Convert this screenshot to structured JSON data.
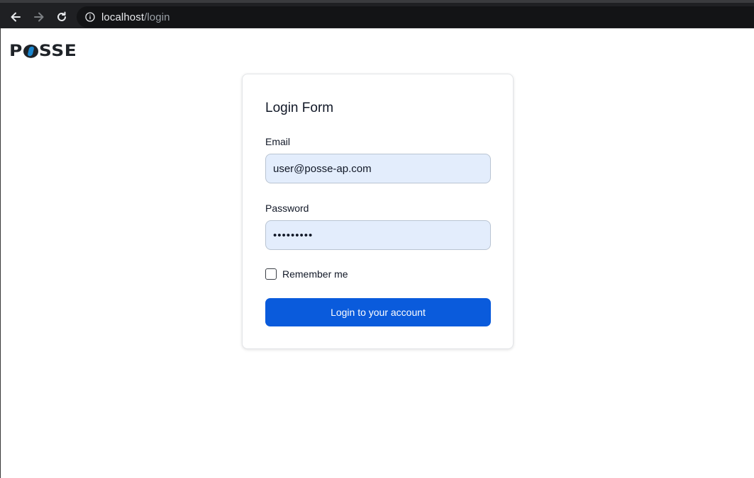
{
  "browser": {
    "url_host": "localhost",
    "url_path": "/login",
    "icons": {
      "back": "arrow-left-icon",
      "forward": "arrow-right-icon",
      "reload": "reload-icon",
      "site_info": "info-icon"
    }
  },
  "header": {
    "logo_text": "POSSE",
    "logo_accent_color": "#1a86cf"
  },
  "login_form": {
    "title": "Login Form",
    "email": {
      "label": "Email",
      "value": "user@posse-ap.com"
    },
    "password": {
      "label": "Password",
      "value": "•••••••••"
    },
    "remember": {
      "label": "Remember me",
      "checked": false
    },
    "submit_label": "Login to your account"
  },
  "colors": {
    "primary_button": "#0a5bdc",
    "input_background": "#e3edfc"
  }
}
